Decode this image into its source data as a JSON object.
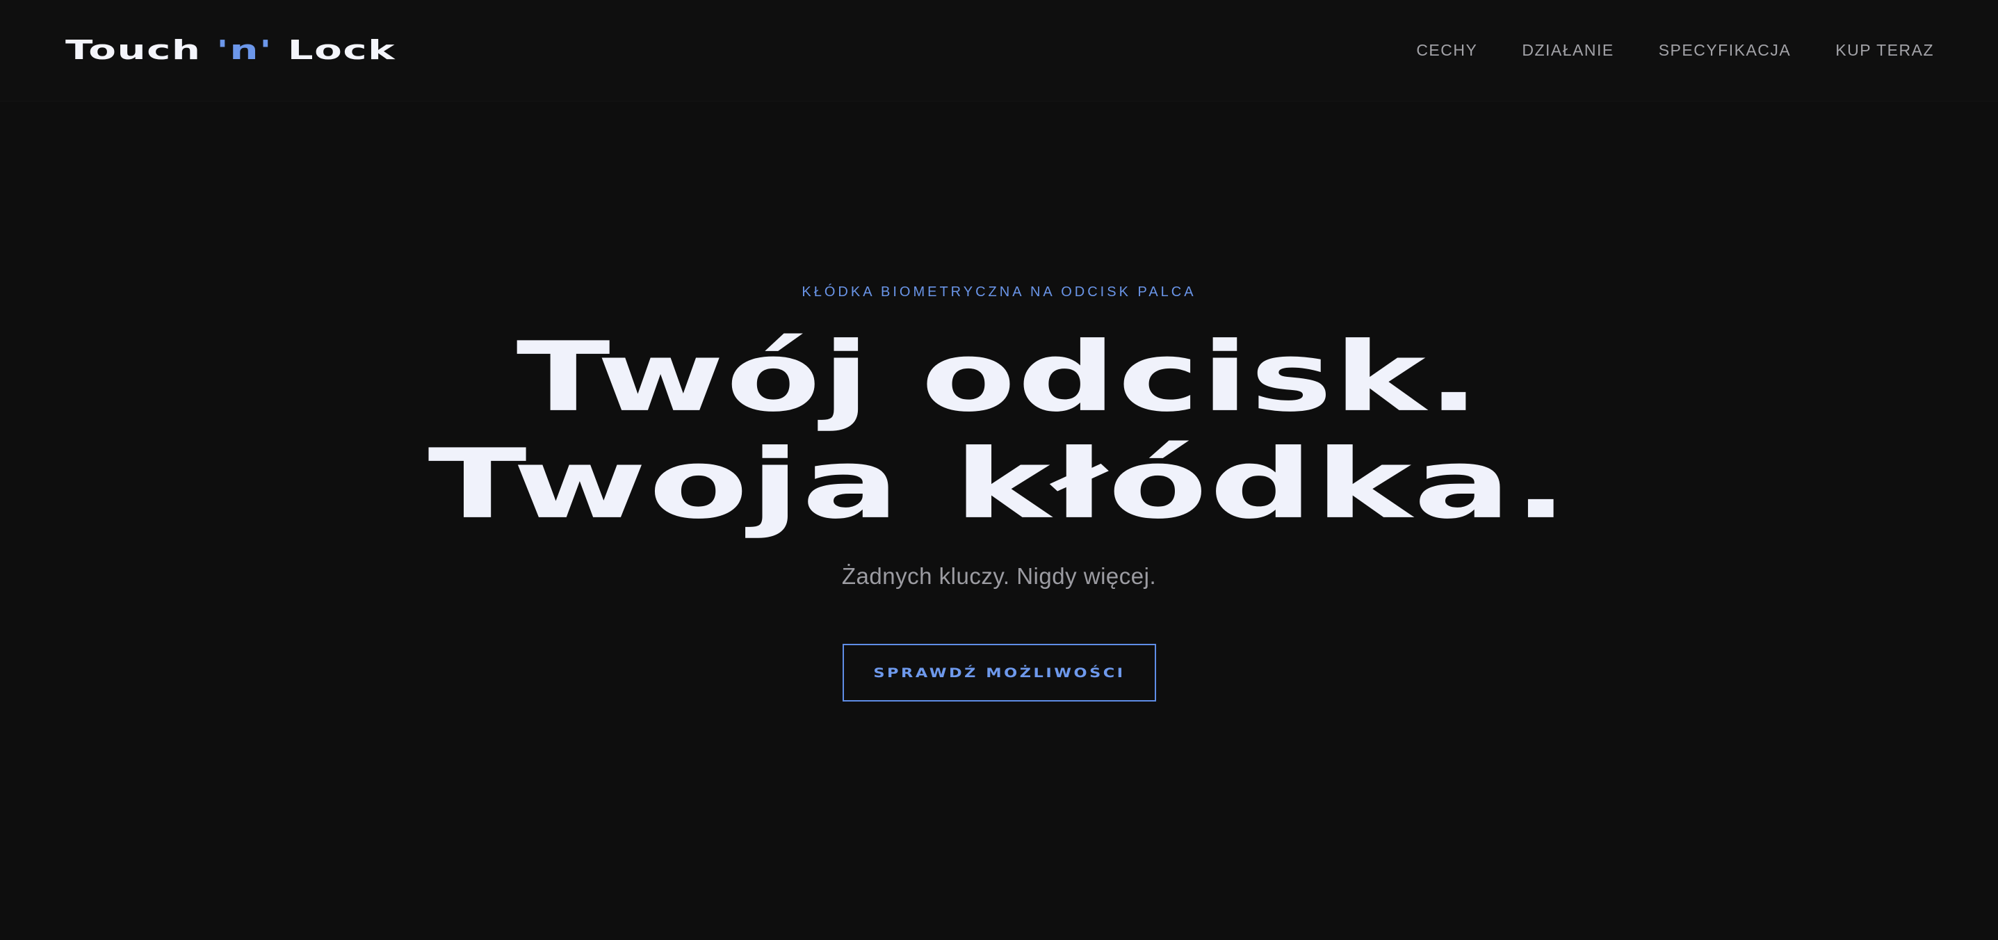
{
  "header": {
    "logo": {
      "part1": "Touch ",
      "accent": "'n'",
      "part2": " Lock"
    },
    "nav": [
      "CECHY",
      "DZIAŁANIE",
      "SPECYFIKACJA",
      "KUP TERAZ"
    ]
  },
  "hero": {
    "eyebrow": "KŁÓDKA BIOMETRYCZNA NA ODCISK PALCA",
    "headline_line1": "Twój odcisk.",
    "headline_line2": "Twoja kłódka.",
    "subtitle": "Żadnych kluczy. Nigdy więcej.",
    "cta_label": "SPRAWDŹ MOŻLIWOŚCI"
  },
  "colors": {
    "background": "#0e0e0e",
    "accent": "#6a95e8",
    "headline": "#f0f2fb",
    "nav_text": "#a3a3a8"
  }
}
